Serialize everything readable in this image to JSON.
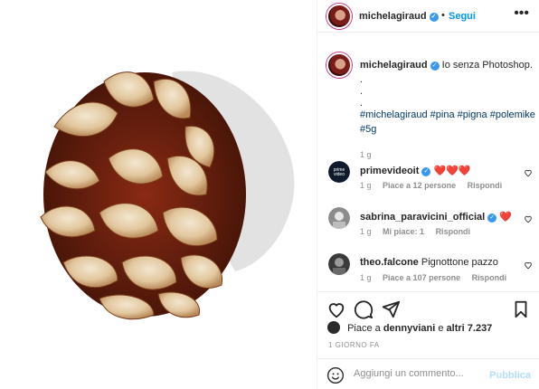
{
  "post": {
    "author": "michelagiraud",
    "separator": "•",
    "follow_label": "Segui",
    "more_label": "•••"
  },
  "caption": {
    "author": "michelagiraud",
    "text": "Io senza Photoshop.",
    "dots": [
      ".",
      ".",
      "."
    ],
    "hashtags": "#michelagiraud #pina #pigna #polemike #5g",
    "time": "1 g"
  },
  "comments": [
    {
      "user": "primevideoit",
      "text": "❤️❤️❤️",
      "time": "1 g",
      "likes": "Piace a 12 persone",
      "reply": "Rispondi",
      "verified": true
    },
    {
      "user": "sabrina_paravicini_official",
      "text": "❤️",
      "time": "1 g",
      "likes": "Mi piace: 1",
      "reply": "Rispondi",
      "verified": true
    },
    {
      "user": "theo.falcone",
      "text": "Pignottone pazzo",
      "time": "1 g",
      "likes": "Piace a 107 persone",
      "reply": "Rispondi",
      "verified": false
    }
  ],
  "likes_line": {
    "prefix": "Piace a",
    "user": "dennyviani",
    "conj": "e",
    "others": "altri 7.237"
  },
  "date_label": "1 GIORNO FA",
  "add_comment": {
    "placeholder": "Aggiungi un commento...",
    "publish_label": "Pubblica"
  },
  "icons": {
    "header_avatar": "avatar-icon",
    "like": "heart-icon",
    "comment": "comment-bubble-icon",
    "share": "paper-plane-icon",
    "save": "bookmark-icon",
    "emoji": "smiley-icon"
  },
  "colors": {
    "link_blue": "#0095f6",
    "hashtag": "#00376b",
    "verified": "#3897f0",
    "heart_red": "#ed4956",
    "muted": "#8e8e8e"
  }
}
